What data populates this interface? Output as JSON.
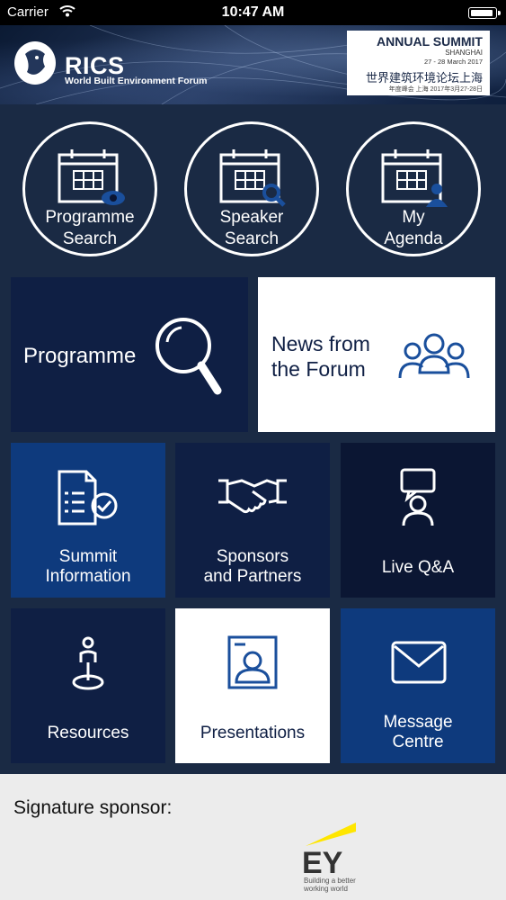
{
  "status_bar": {
    "carrier": "Carrier",
    "time": "10:47 AM",
    "battery_level": 0.9
  },
  "header": {
    "org": "RICS",
    "org_sub": "World Built Environment Forum",
    "summit": {
      "title": "ANNUAL SUMMIT",
      "city": "SHANGHAI",
      "dates": "27 - 28 March 2017",
      "chinese_title": "世界建筑环境论坛上海",
      "chinese_dates": "年度峰会 上海 2017年3月27-28日"
    }
  },
  "quick_actions": [
    {
      "label_line1": "Programme",
      "label_line2": "Search",
      "icon": "calendar-eye-icon"
    },
    {
      "label_line1": "Speaker",
      "label_line2": "Search",
      "icon": "calendar-search-icon"
    },
    {
      "label_line1": "My",
      "label_line2": "Agenda",
      "icon": "calendar-person-icon"
    }
  ],
  "big_tiles": {
    "programme": {
      "label": "Programme",
      "icon": "magnifier-icon"
    },
    "news": {
      "label_line1": "News from",
      "label_line2": "the Forum",
      "icon": "group-icon"
    }
  },
  "grid_tiles": [
    {
      "label_line1": "Summit",
      "label_line2": "Information",
      "icon": "document-check-icon"
    },
    {
      "label_line1": "Sponsors",
      "label_line2": "and Partners",
      "icon": "handshake-icon"
    },
    {
      "label_line1": "Live Q&A",
      "label_line2": "",
      "icon": "chat-person-icon"
    },
    {
      "label_line1": "Resources",
      "label_line2": "",
      "icon": "location-pin-icon"
    },
    {
      "label_line1": "Presentations",
      "label_line2": "",
      "icon": "presentation-portrait-icon"
    },
    {
      "label_line1": "Message",
      "label_line2": "Centre",
      "icon": "envelope-icon"
    }
  ],
  "sponsor": {
    "title": "Signature sponsor:",
    "logo_text": "EY",
    "tagline_line1": "Building a better",
    "tagline_line2": "working world"
  },
  "colors": {
    "background": "#1a2a44",
    "dark_tile": "#0f1f44",
    "darker_tile": "#0b1633",
    "blue_tile": "#0e3a7d",
    "white_tile": "#ffffff",
    "icon_blue": "#1a4f9c",
    "ey_yellow": "#ffe600"
  }
}
